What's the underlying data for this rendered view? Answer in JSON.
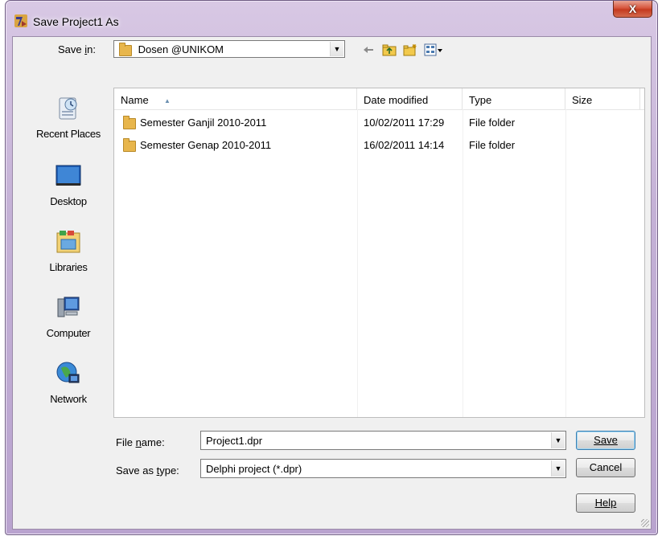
{
  "window": {
    "title": "Save Project1 As",
    "close_glyph": "X"
  },
  "save_in": {
    "label": "Save in:",
    "label_access": "i",
    "value": "Dosen @UNIKOM"
  },
  "toolbar": {
    "back_icon": "back-arrow-icon",
    "up_icon": "up-folder-icon",
    "new_folder_icon": "new-folder-icon",
    "view_icon": "view-menu-icon"
  },
  "places": [
    {
      "label": "Recent Places",
      "icon": "recent-places-icon"
    },
    {
      "label": "Desktop",
      "icon": "desktop-icon"
    },
    {
      "label": "Libraries",
      "icon": "libraries-icon"
    },
    {
      "label": "Computer",
      "icon": "computer-icon"
    },
    {
      "label": "Network",
      "icon": "network-icon"
    }
  ],
  "columns": {
    "name": "Name",
    "date": "Date modified",
    "type": "Type",
    "size": "Size"
  },
  "files": [
    {
      "name": "Semester Ganjil 2010-2011",
      "date": "10/02/2011 17:29",
      "type": "File folder",
      "size": ""
    },
    {
      "name": "Semester Genap 2010-2011",
      "date": "16/02/2011 14:14",
      "type": "File folder",
      "size": ""
    }
  ],
  "file_name": {
    "label": "File name:",
    "value": "Project1.dpr"
  },
  "save_as_type": {
    "label": "Save as type:",
    "value": "Delphi project (*.dpr)"
  },
  "buttons": {
    "save": "Save",
    "cancel": "Cancel",
    "help": "Help"
  },
  "colors": {
    "title_frame": "#c4b1d6",
    "close_red": "#d7563d",
    "folder": "#e8b64c",
    "client_bg": "#f0f0f0"
  }
}
